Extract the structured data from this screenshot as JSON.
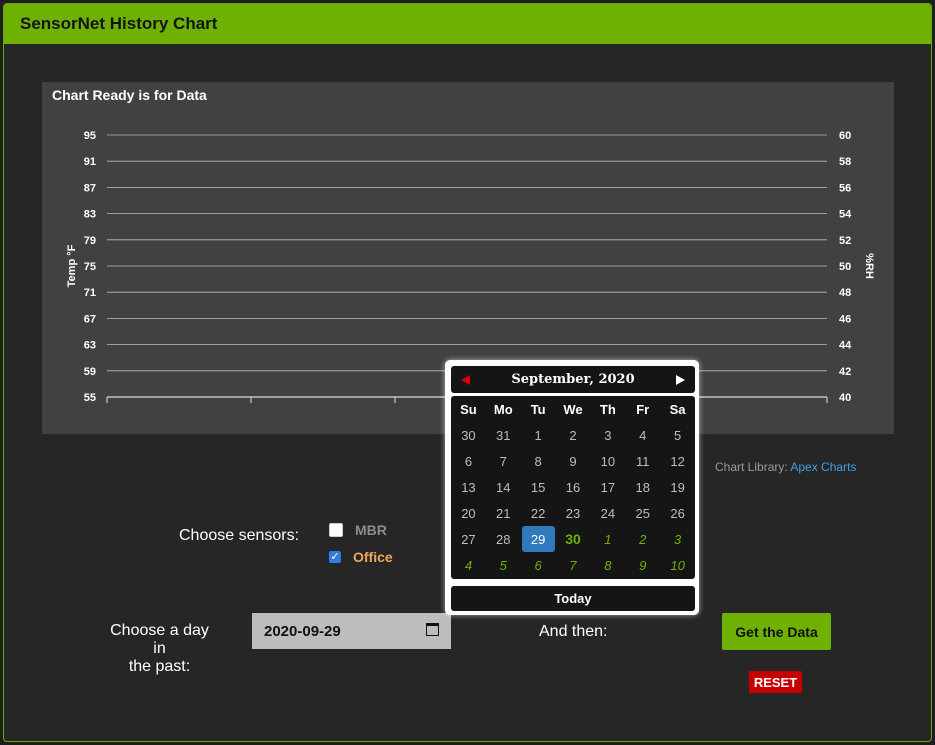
{
  "header": {
    "title": "SensorNet History Chart"
  },
  "chart": {
    "title": "Chart Ready is for Data",
    "credit_prefix": "Chart Library: ",
    "credit_link": "Apex Charts"
  },
  "chart_data": {
    "type": "line",
    "title": "Chart Ready is for Data",
    "ylabel": "Temp °F",
    "y2label": "%RH",
    "y_ticks": [
      95,
      91,
      87,
      83,
      79,
      75,
      71,
      67,
      63,
      59,
      55
    ],
    "y2_ticks": [
      60,
      58,
      56,
      54,
      52,
      50,
      48,
      46,
      44,
      42,
      40
    ],
    "ylim": [
      55,
      95
    ],
    "y2lim": [
      40,
      60
    ],
    "series": [],
    "grid": true
  },
  "form": {
    "sensors_label": "Choose sensors:",
    "sensors": [
      {
        "name": "MBR",
        "checked": false,
        "color": "#8c8c8c"
      },
      {
        "name": "Office",
        "checked": true,
        "color": "#f2a55a"
      }
    ],
    "day_label_line1": "Choose a day in",
    "day_label_line2": "the past:",
    "date_value": "2020-09-29",
    "then_label": "And then:",
    "get_button": "Get the Data",
    "reset_button": "RESET"
  },
  "calendar": {
    "month_title": "September, 2020",
    "weekdays": [
      "Su",
      "Mo",
      "Tu",
      "We",
      "Th",
      "Fr",
      "Sa"
    ],
    "weeks": [
      [
        "30",
        "31",
        "1",
        "2",
        "3",
        "4",
        "5"
      ],
      [
        "6",
        "7",
        "8",
        "9",
        "10",
        "11",
        "12"
      ],
      [
        "13",
        "14",
        "15",
        "16",
        "17",
        "18",
        "19"
      ],
      [
        "20",
        "21",
        "22",
        "23",
        "24",
        "25",
        "26"
      ],
      [
        "27",
        "28",
        "29",
        "30",
        "1",
        "2",
        "3"
      ],
      [
        "4",
        "5",
        "6",
        "7",
        "8",
        "9",
        "10"
      ]
    ],
    "selected": "29",
    "today": "30",
    "today_button": "Today"
  }
}
